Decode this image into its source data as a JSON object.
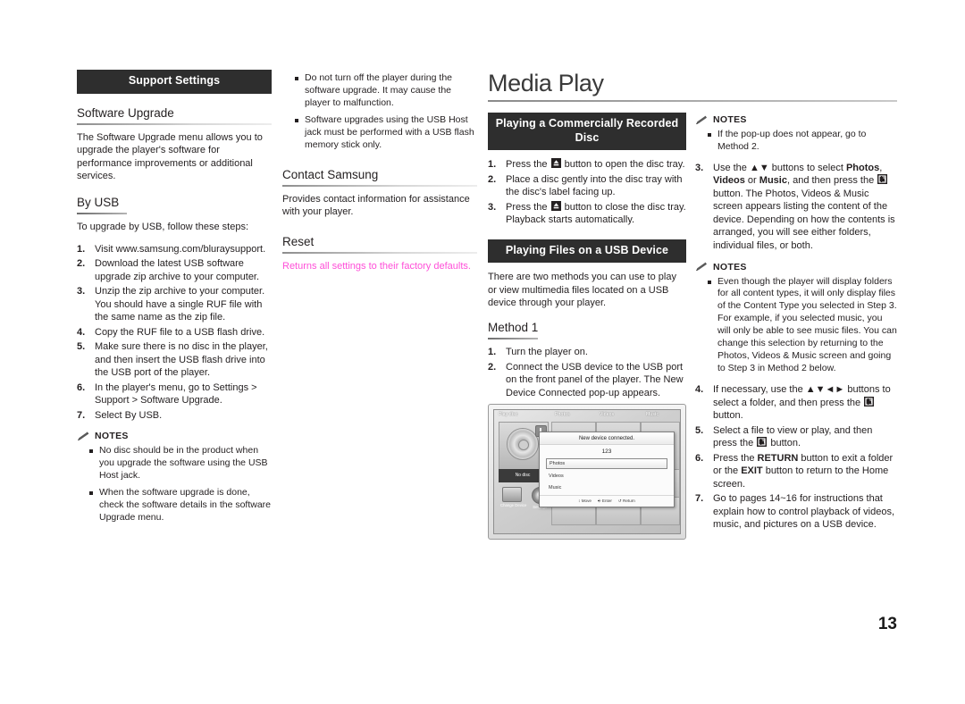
{
  "page_number": "13",
  "column1": {
    "banner": "Support Settings",
    "software_upgrade": {
      "heading": "Software Upgrade",
      "body": "The Software Upgrade menu allows you to upgrade the player's software for performance improvements or additional services."
    },
    "by_usb": {
      "heading": "By USB",
      "intro": "To upgrade by USB, follow these steps:",
      "steps": [
        {
          "num": "1.",
          "text": "Visit www.samsung.com/bluraysupport."
        },
        {
          "num": "2.",
          "text": "Download the latest USB software upgrade zip archive to your computer."
        },
        {
          "num": "3.",
          "text": "Unzip the zip archive to your computer. You should have a single RUF file with the same name as the zip file."
        },
        {
          "num": "4.",
          "text": "Copy the RUF file to a USB flash drive."
        },
        {
          "num": "5.",
          "text": "Make sure there is no disc in the player, and then insert the USB flash drive into the USB port of the player."
        },
        {
          "num": "6.",
          "text": "In the player's menu, go to Settings > Support > Software Upgrade."
        },
        {
          "num": "7.",
          "text": "Select By USB."
        }
      ]
    },
    "notes": {
      "title": "NOTES",
      "items": [
        "No disc should be in the product when you upgrade the software using the USB Host jack.",
        "When the software upgrade is done, check the software details in the software Upgrade menu."
      ]
    }
  },
  "column2": {
    "notes_continued": [
      "Do not turn off the player during the software upgrade. It may cause the player to malfunction.",
      "Software upgrades using the USB Host jack must be performed with a USB flash memory stick only."
    ],
    "contact_samsung": {
      "heading": "Contact Samsung",
      "body": "Provides contact information for assistance with your player."
    },
    "reset": {
      "heading": "Reset",
      "body": "Returns all settings to their factory defaults.",
      "body_color": "#ff4fd8"
    }
  },
  "column3": {
    "page_title": "Media Play",
    "banner_disc": "Playing a Commercially Recorded Disc",
    "disc_steps": [
      {
        "num": "1.",
        "pre": "Press the ",
        "icon": "eject-icon",
        "post": " button to open the disc tray."
      },
      {
        "num": "2.",
        "pre": "Place a disc gently into the disc tray with the disc's label facing up.",
        "icon": "",
        "post": ""
      },
      {
        "num": "3.",
        "pre": "Press the ",
        "icon": "eject-icon",
        "post": " button to close the disc tray. Playback starts automatically."
      }
    ],
    "banner_usb": "Playing Files on a USB Device",
    "usb_intro": "There are two methods you can use to play or view multimedia files located on a USB device through your player.",
    "method1": {
      "heading": "Method 1",
      "steps": [
        {
          "num": "1.",
          "text": "Turn the player on."
        },
        {
          "num": "2.",
          "text": "Connect the USB device to the USB port on the front panel of the player. The New Device Connected pop-up appears."
        }
      ]
    },
    "screen_illustration": {
      "home_labels": [
        "Play disc",
        "Photos",
        "Videos",
        "Music"
      ],
      "no_disc_label": "No disc",
      "change_device_label": "Change Device",
      "settings_label": "Settings",
      "popup_title": "New device connected.",
      "popup_device_name": "123",
      "popup_items": [
        "Photos",
        "Videos",
        "Music"
      ],
      "popup_selected": "Photos",
      "popup_footer": [
        "Move",
        "Enter",
        "Return"
      ]
    }
  },
  "column4": {
    "notes1": {
      "title": "NOTES",
      "items": [
        "If the pop-up does not appear, go to Method 2."
      ]
    },
    "step3": {
      "num": "3.",
      "seg1": "Use the ",
      "arrows1": "▲▼",
      "seg2": " buttons to select ",
      "kw1": "Photos",
      "seg3": ", ",
      "kw2": "Videos",
      "seg4": " or ",
      "kw3": "Music",
      "seg5": ", and then press the ",
      "icon": "enter-icon",
      "seg6": " button. The Photos, Videos & Music screen appears listing the content of the device. Depending on how the contents is arranged, you will see either folders, individual files, or both."
    },
    "notes2": {
      "title": "NOTES",
      "items": [
        "Even though the player will display folders for all content types, it will only display files of the Content Type you selected in Step 3. For example, if you selected music, you will only be able to see music files. You can change this selection by returning to the Photos, Videos & Music screen and going to Step 3 in Method 2 below."
      ]
    },
    "steps_rest": [
      {
        "num": "4.",
        "seg1": "If necessary, use the ",
        "arrows1": "▲▼◄►",
        "seg2": " buttons to select a folder, and then press the ",
        "icon": "enter-icon",
        "seg3": " button."
      },
      {
        "num": "5.",
        "seg1": "Select a file to view or play, and then press the ",
        "arrows1": "",
        "seg2": "",
        "icon": "enter-icon",
        "seg3": " button."
      }
    ],
    "step6": {
      "num": "6.",
      "seg1": "Press the ",
      "kw1": "RETURN",
      "seg2": " button to exit a folder or the ",
      "kw2": "EXIT",
      "seg3": " button to return to the Home screen."
    },
    "step7": {
      "num": "7.",
      "text": "Go to pages 14~16 for instructions that explain how to control playback of videos, music, and pictures on a USB device."
    }
  }
}
